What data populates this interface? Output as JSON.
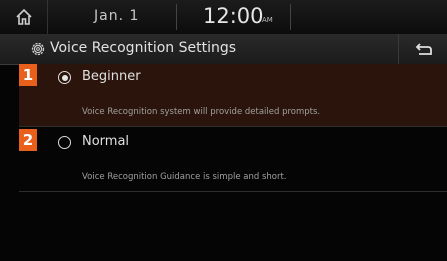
{
  "status": {
    "date": "Jan.  1",
    "time": "12:00",
    "ampm": "AM"
  },
  "header": {
    "title": "Voice Recognition Settings"
  },
  "options": [
    {
      "number": "1",
      "label": "Beginner",
      "description": "Voice Recognition system will provide detailed prompts.",
      "selected": true
    },
    {
      "number": "2",
      "label": "Normal",
      "description": "Voice Recognition Guidance is simple and short.",
      "selected": false
    }
  ],
  "icons": {
    "home": "home-icon",
    "settings": "gear-icon",
    "back": "back-arrow-icon"
  },
  "colors": {
    "badge": "#e8601c",
    "selected_row": "#2b140c"
  }
}
